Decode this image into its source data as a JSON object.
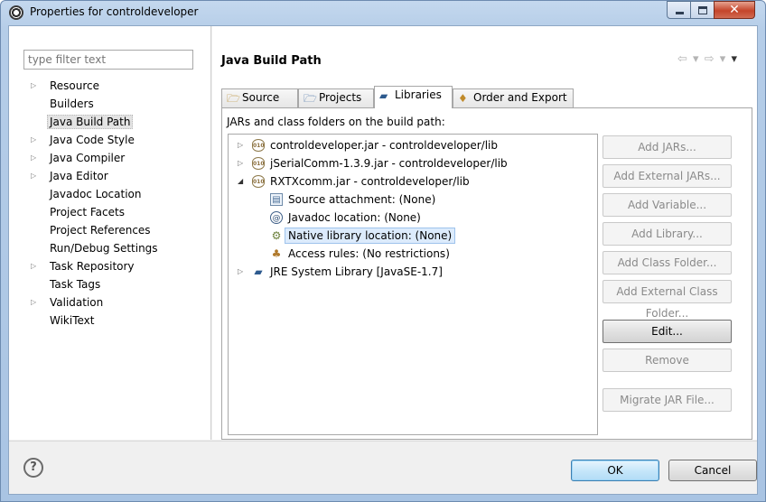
{
  "window": {
    "title": "Properties for controldeveloper"
  },
  "filter": {
    "placeholder": "type filter text"
  },
  "nav": {
    "items": [
      {
        "label": "Resource",
        "expandable": true
      },
      {
        "label": "Builders",
        "expandable": false
      },
      {
        "label": "Java Build Path",
        "expandable": false,
        "selected": true
      },
      {
        "label": "Java Code Style",
        "expandable": true
      },
      {
        "label": "Java Compiler",
        "expandable": true
      },
      {
        "label": "Java Editor",
        "expandable": true
      },
      {
        "label": "Javadoc Location",
        "expandable": false
      },
      {
        "label": "Project Facets",
        "expandable": false
      },
      {
        "label": "Project References",
        "expandable": false
      },
      {
        "label": "Run/Debug Settings",
        "expandable": false
      },
      {
        "label": "Task Repository",
        "expandable": true
      },
      {
        "label": "Task Tags",
        "expandable": false
      },
      {
        "label": "Validation",
        "expandable": true
      },
      {
        "label": "WikiText",
        "expandable": false
      }
    ]
  },
  "page": {
    "title": "Java Build Path"
  },
  "tabs": [
    {
      "label": "Source"
    },
    {
      "label": "Projects"
    },
    {
      "label": "Libraries",
      "active": true
    },
    {
      "label": "Order and Export"
    }
  ],
  "libraries": {
    "description": "JARs and class folders on the build path:",
    "tree": [
      {
        "label": "controldeveloper.jar - controldeveloper/lib",
        "icon": "jar-icon",
        "state": "collapsed"
      },
      {
        "label": "jSerialComm-1.3.9.jar - controldeveloper/lib",
        "icon": "jar-icon",
        "state": "collapsed"
      },
      {
        "label": "RXTXcomm.jar - controldeveloper/lib",
        "icon": "jar-icon",
        "state": "expanded"
      },
      {
        "label": "Source attachment: (None)",
        "icon": "source-attachment-icon"
      },
      {
        "label": "Javadoc location: (None)",
        "icon": "javadoc-icon"
      },
      {
        "label": "Native library location: (None)",
        "icon": "native-library-icon",
        "selected": true
      },
      {
        "label": "Access rules: (No restrictions)",
        "icon": "access-rules-icon"
      },
      {
        "label": "JRE System Library [JavaSE-1.7]",
        "icon": "library-icon",
        "state": "collapsed"
      }
    ],
    "buttons": [
      {
        "label": "Add JARs...",
        "enabled": false
      },
      {
        "label": "Add External JARs...",
        "enabled": false
      },
      {
        "label": "Add Variable...",
        "enabled": false
      },
      {
        "label": "Add Library...",
        "enabled": false
      },
      {
        "label": "Add Class Folder...",
        "enabled": false
      },
      {
        "label": "Add External Class Folder...",
        "enabled": false
      },
      {
        "label": "Edit...",
        "enabled": true
      },
      {
        "label": "Remove",
        "enabled": false
      },
      {
        "label": "Migrate JAR File...",
        "enabled": false
      }
    ]
  },
  "footer": {
    "help": "?",
    "ok": "OK",
    "cancel": "Cancel"
  }
}
